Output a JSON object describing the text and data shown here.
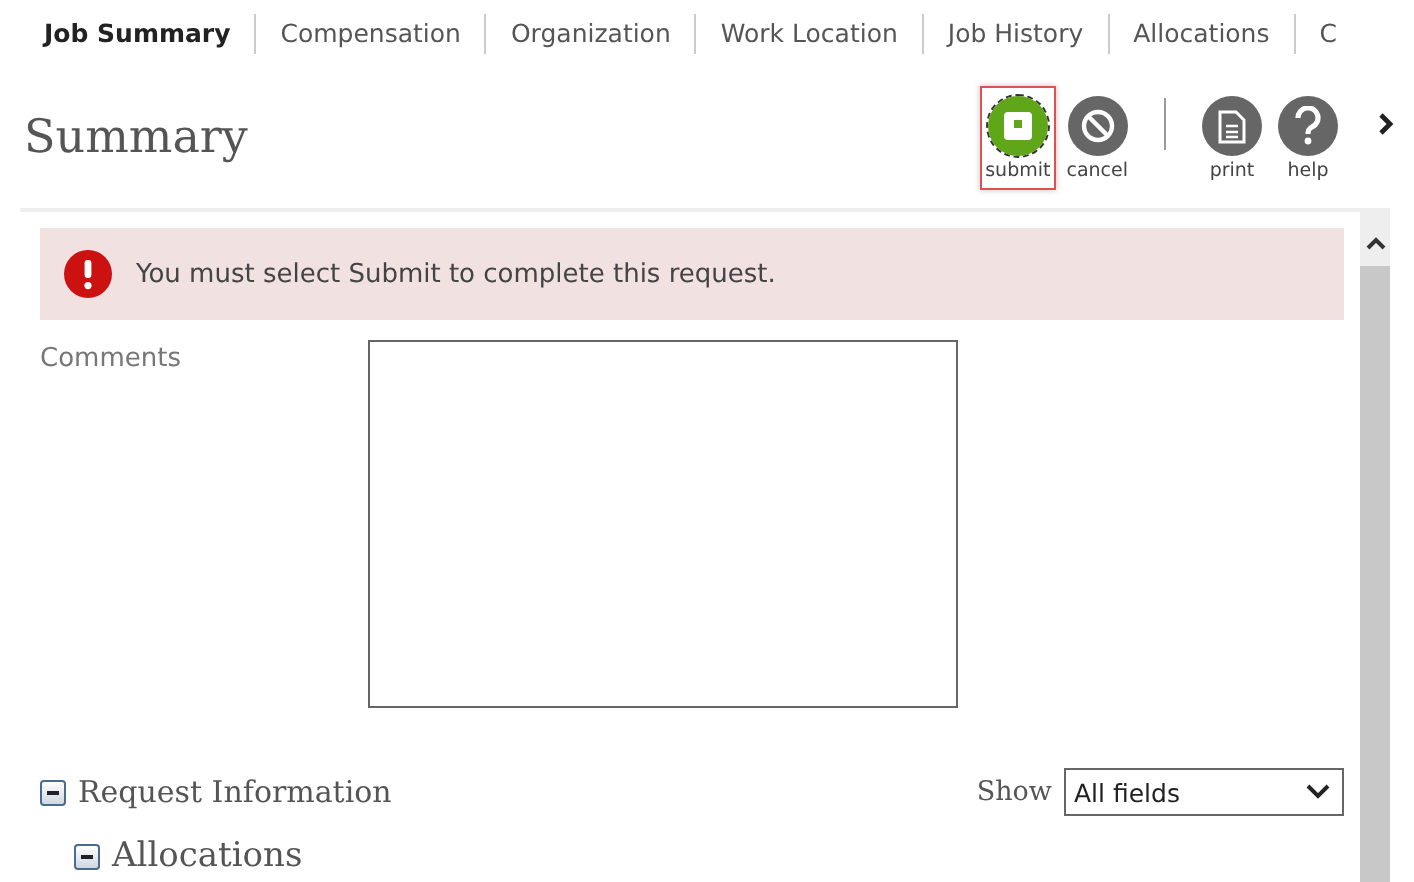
{
  "tabs": [
    {
      "label": "Job Summary",
      "selected": true
    },
    {
      "label": "Compensation",
      "selected": false
    },
    {
      "label": "Organization",
      "selected": false
    },
    {
      "label": "Work Location",
      "selected": false
    },
    {
      "label": "Job History",
      "selected": false
    },
    {
      "label": "Allocations",
      "selected": false
    },
    {
      "label": "C",
      "selected": false
    }
  ],
  "page_title": "Summary",
  "toolbar": [
    {
      "kind": "submit",
      "label": "submit",
      "focused": true
    },
    {
      "kind": "cancel",
      "label": "cancel",
      "focused": false
    },
    {
      "kind": "divider"
    },
    {
      "kind": "print",
      "label": "print",
      "focused": false
    },
    {
      "kind": "help",
      "label": "help",
      "focused": false
    }
  ],
  "alert": {
    "message": "You must select Submit to complete this request."
  },
  "comments": {
    "label": "Comments"
  },
  "sections": [
    {
      "title": "Request Information",
      "expanded": true,
      "children": [
        {
          "title": "Allocations",
          "expanded": true
        }
      ]
    }
  ],
  "show": {
    "label": "Show",
    "value": "All fields"
  }
}
